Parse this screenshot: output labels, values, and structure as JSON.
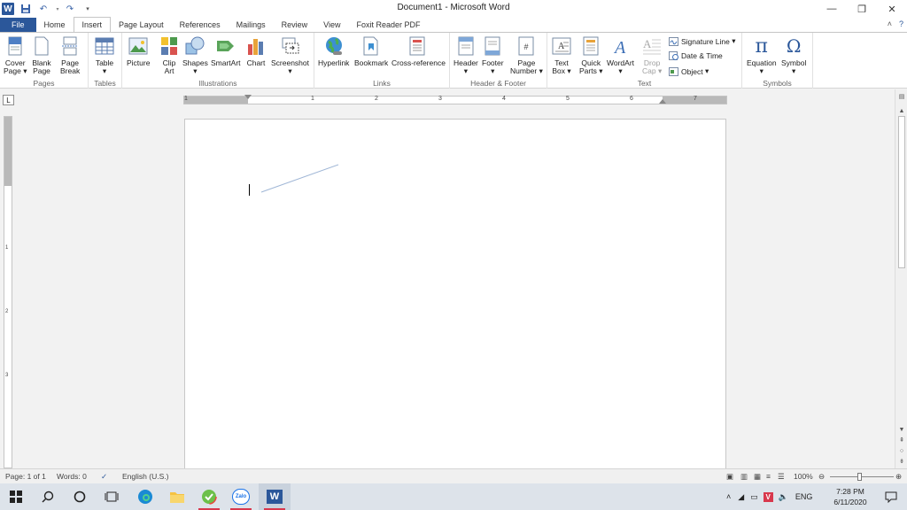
{
  "title_bar": {
    "title": "Document1 - Microsoft Word",
    "app_icon": "W"
  },
  "tabs": [
    "File",
    "Home",
    "Insert",
    "Page Layout",
    "References",
    "Mailings",
    "Review",
    "View",
    "Foxit Reader PDF"
  ],
  "active_tab": "Insert",
  "ribbon": {
    "pages": {
      "label": "Pages",
      "cover": [
        "Cover",
        "Page"
      ],
      "blank": [
        "Blank",
        "Page"
      ],
      "break": [
        "Page",
        "Break"
      ]
    },
    "tables": {
      "label": "Tables",
      "table": "Table"
    },
    "illustrations": {
      "label": "Illustrations",
      "picture": "Picture",
      "clipart": [
        "Clip",
        "Art"
      ],
      "shapes": "Shapes",
      "smartart": "SmartArt",
      "chart": "Chart",
      "screenshot": "Screenshot"
    },
    "links": {
      "label": "Links",
      "hyperlink": "Hyperlink",
      "bookmark": "Bookmark",
      "crossref": "Cross-reference"
    },
    "header_footer": {
      "label": "Header & Footer",
      "header": "Header",
      "footer": "Footer",
      "page_number": [
        "Page",
        "Number"
      ]
    },
    "text": {
      "label": "Text",
      "textbox": [
        "Text",
        "Box"
      ],
      "quickparts": [
        "Quick",
        "Parts"
      ],
      "wordart": "WordArt",
      "dropcap": [
        "Drop",
        "Cap"
      ],
      "signature": "Signature Line",
      "datetime": "Date & Time",
      "object": "Object"
    },
    "symbols": {
      "label": "Symbols",
      "equation": "Equation",
      "symbol": "Symbol",
      "pi_glyph": "π",
      "omega_glyph": "Ω"
    }
  },
  "ruler": {
    "numbers": [
      "1",
      "1",
      "2",
      "3",
      "4",
      "5",
      "6",
      "7"
    ],
    "vnumbers": [
      "1",
      "2",
      "3"
    ]
  },
  "status_bar": {
    "page": "Page: 1 of 1",
    "words": "Words: 0",
    "language": "English (U.S.)",
    "zoom": "100%"
  },
  "taskbar": {
    "lang": "ENG",
    "time": "7:28 PM",
    "date": "6/11/2020",
    "zalo": "Zalo"
  },
  "colors": {
    "word_blue": "#2b579a",
    "taskbar_bg": "#dde3ea",
    "running_indicator": "#d8384d"
  }
}
